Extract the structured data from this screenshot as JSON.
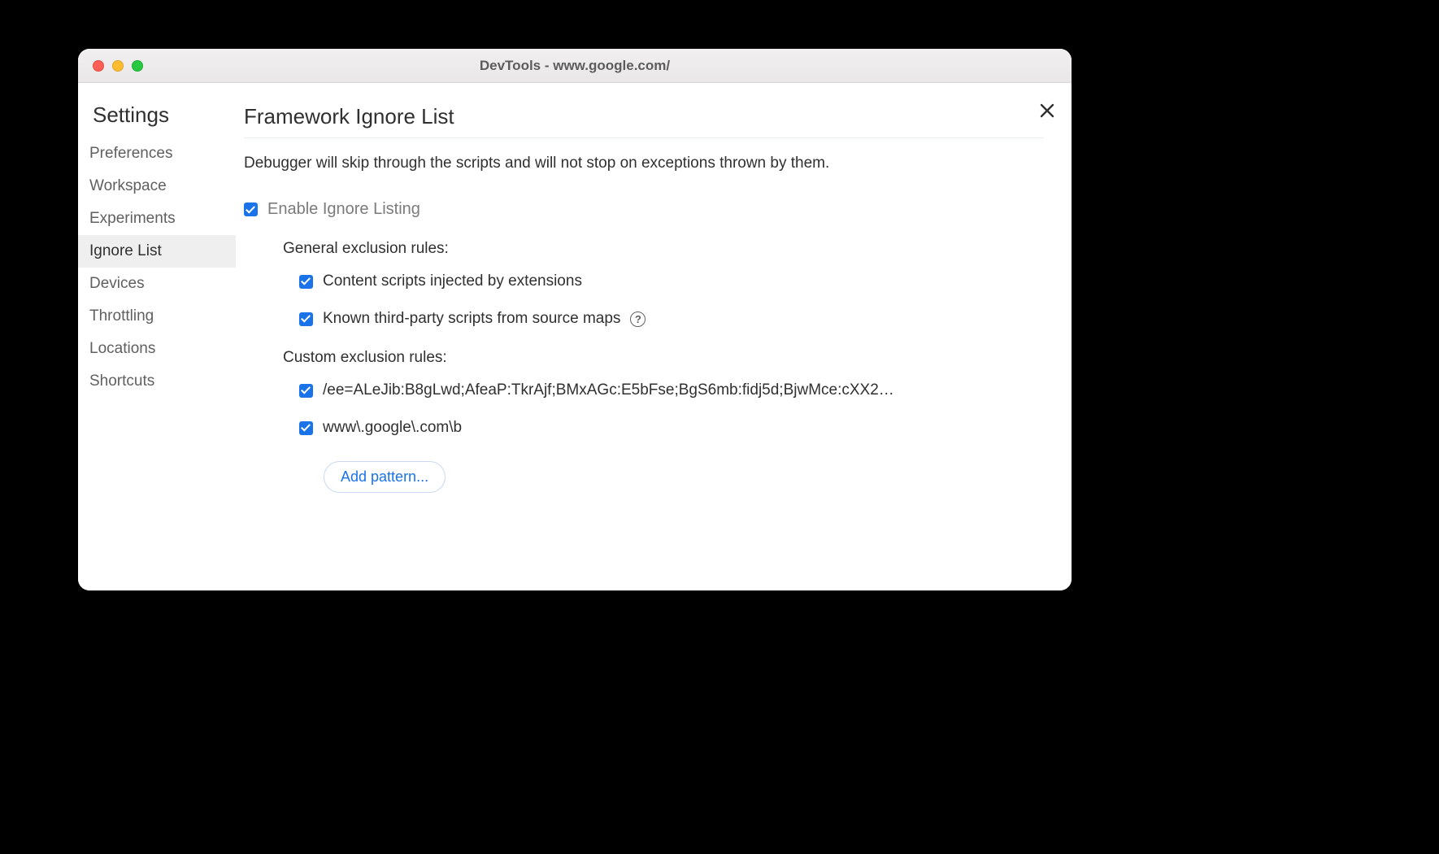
{
  "window": {
    "title": "DevTools - www.google.com/"
  },
  "sidebar": {
    "title": "Settings",
    "items": [
      {
        "label": "Preferences",
        "selected": false
      },
      {
        "label": "Workspace",
        "selected": false
      },
      {
        "label": "Experiments",
        "selected": false
      },
      {
        "label": "Ignore List",
        "selected": true
      },
      {
        "label": "Devices",
        "selected": false
      },
      {
        "label": "Throttling",
        "selected": false
      },
      {
        "label": "Locations",
        "selected": false
      },
      {
        "label": "Shortcuts",
        "selected": false
      }
    ]
  },
  "main": {
    "title": "Framework Ignore List",
    "description": "Debugger will skip through the scripts and will not stop on exceptions thrown by them.",
    "enable_label": "Enable Ignore Listing",
    "enable_checked": true,
    "general_heading": "General exclusion rules:",
    "general_rules": [
      {
        "label": "Content scripts injected by extensions",
        "checked": true,
        "help": false
      },
      {
        "label": "Known third-party scripts from source maps",
        "checked": true,
        "help": true
      }
    ],
    "custom_heading": "Custom exclusion rules:",
    "custom_rules": [
      {
        "label": "/ee=ALeJib:B8gLwd;AfeaP:TkrAjf;BMxAGc:E5bFse;BgS6mb:fidj5d;BjwMce:cXX2…",
        "checked": true
      },
      {
        "label": "www\\.google\\.com\\b",
        "checked": true
      }
    ],
    "add_pattern_label": "Add pattern..."
  }
}
